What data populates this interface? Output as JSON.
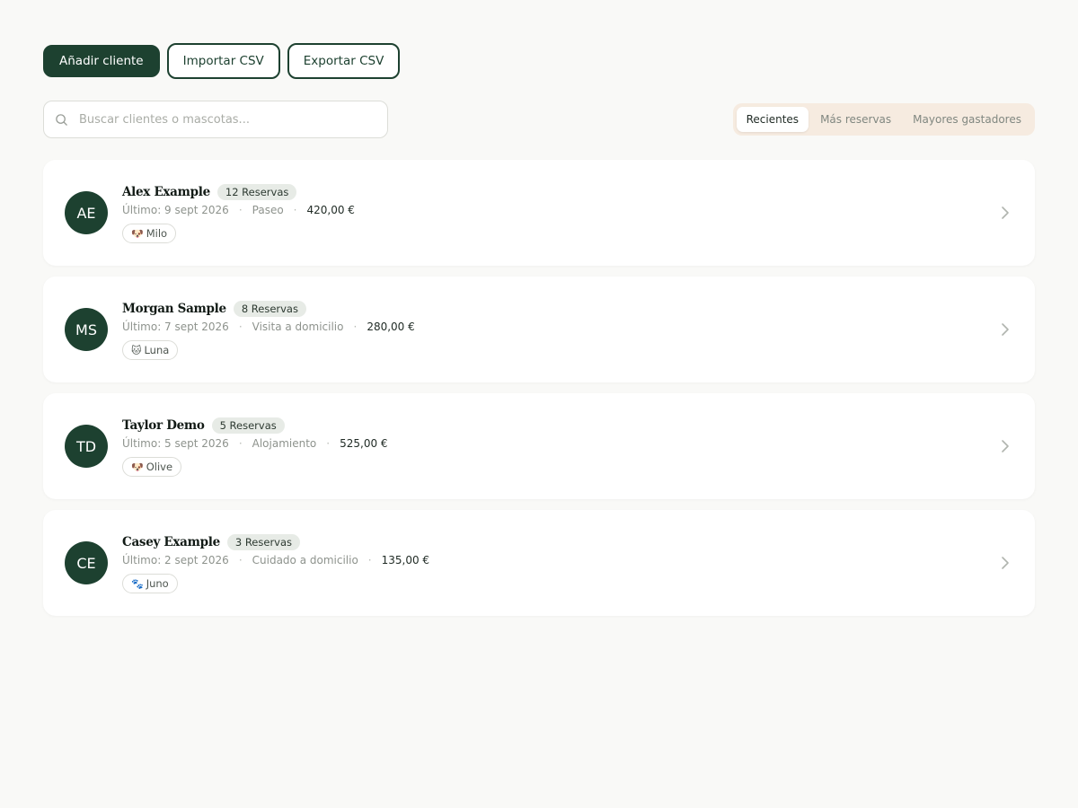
{
  "toolbar": {
    "add_label": "Añadir cliente",
    "import_label": "Importar CSV",
    "export_label": "Exportar CSV"
  },
  "search": {
    "placeholder": "Buscar clientes o mascotas...",
    "value": ""
  },
  "sort_tabs": [
    {
      "label": "Recientes",
      "active": true
    },
    {
      "label": "Más reservas",
      "active": false
    },
    {
      "label": "Mayores gastadores",
      "active": false
    }
  ],
  "colors": {
    "accent": "#1d4130",
    "background": "#f9f9f7",
    "segmented_bg": "#f6ebe0"
  },
  "clients": [
    {
      "initials": "AE",
      "name": "Alex Example",
      "bookings": "12 Reservas",
      "last": "Último: 9 sept 2026",
      "service": "Paseo",
      "amount": "420,00 €",
      "pets": [
        {
          "icon": "dog-icon",
          "glyph": "🐶",
          "name": "Milo"
        }
      ]
    },
    {
      "initials": "MS",
      "name": "Morgan Sample",
      "bookings": "8 Reservas",
      "last": "Último: 7 sept 2026",
      "service": "Visita a domicilio",
      "amount": "280,00 €",
      "pets": [
        {
          "icon": "cat-icon",
          "glyph": "🐱",
          "name": "Luna"
        }
      ]
    },
    {
      "initials": "TD",
      "name": "Taylor Demo",
      "bookings": "5 Reservas",
      "last": "Último: 5 sept 2026",
      "service": "Alojamiento",
      "amount": "525,00 €",
      "pets": [
        {
          "icon": "dog-icon",
          "glyph": "🐶",
          "name": "Olive"
        }
      ]
    },
    {
      "initials": "CE",
      "name": "Casey Example",
      "bookings": "3 Reservas",
      "last": "Último: 2 sept 2026",
      "service": "Cuidado a domicilio",
      "amount": "135,00 €",
      "pets": [
        {
          "icon": "paw-icon",
          "glyph": "🐾",
          "name": "Juno"
        }
      ]
    }
  ]
}
